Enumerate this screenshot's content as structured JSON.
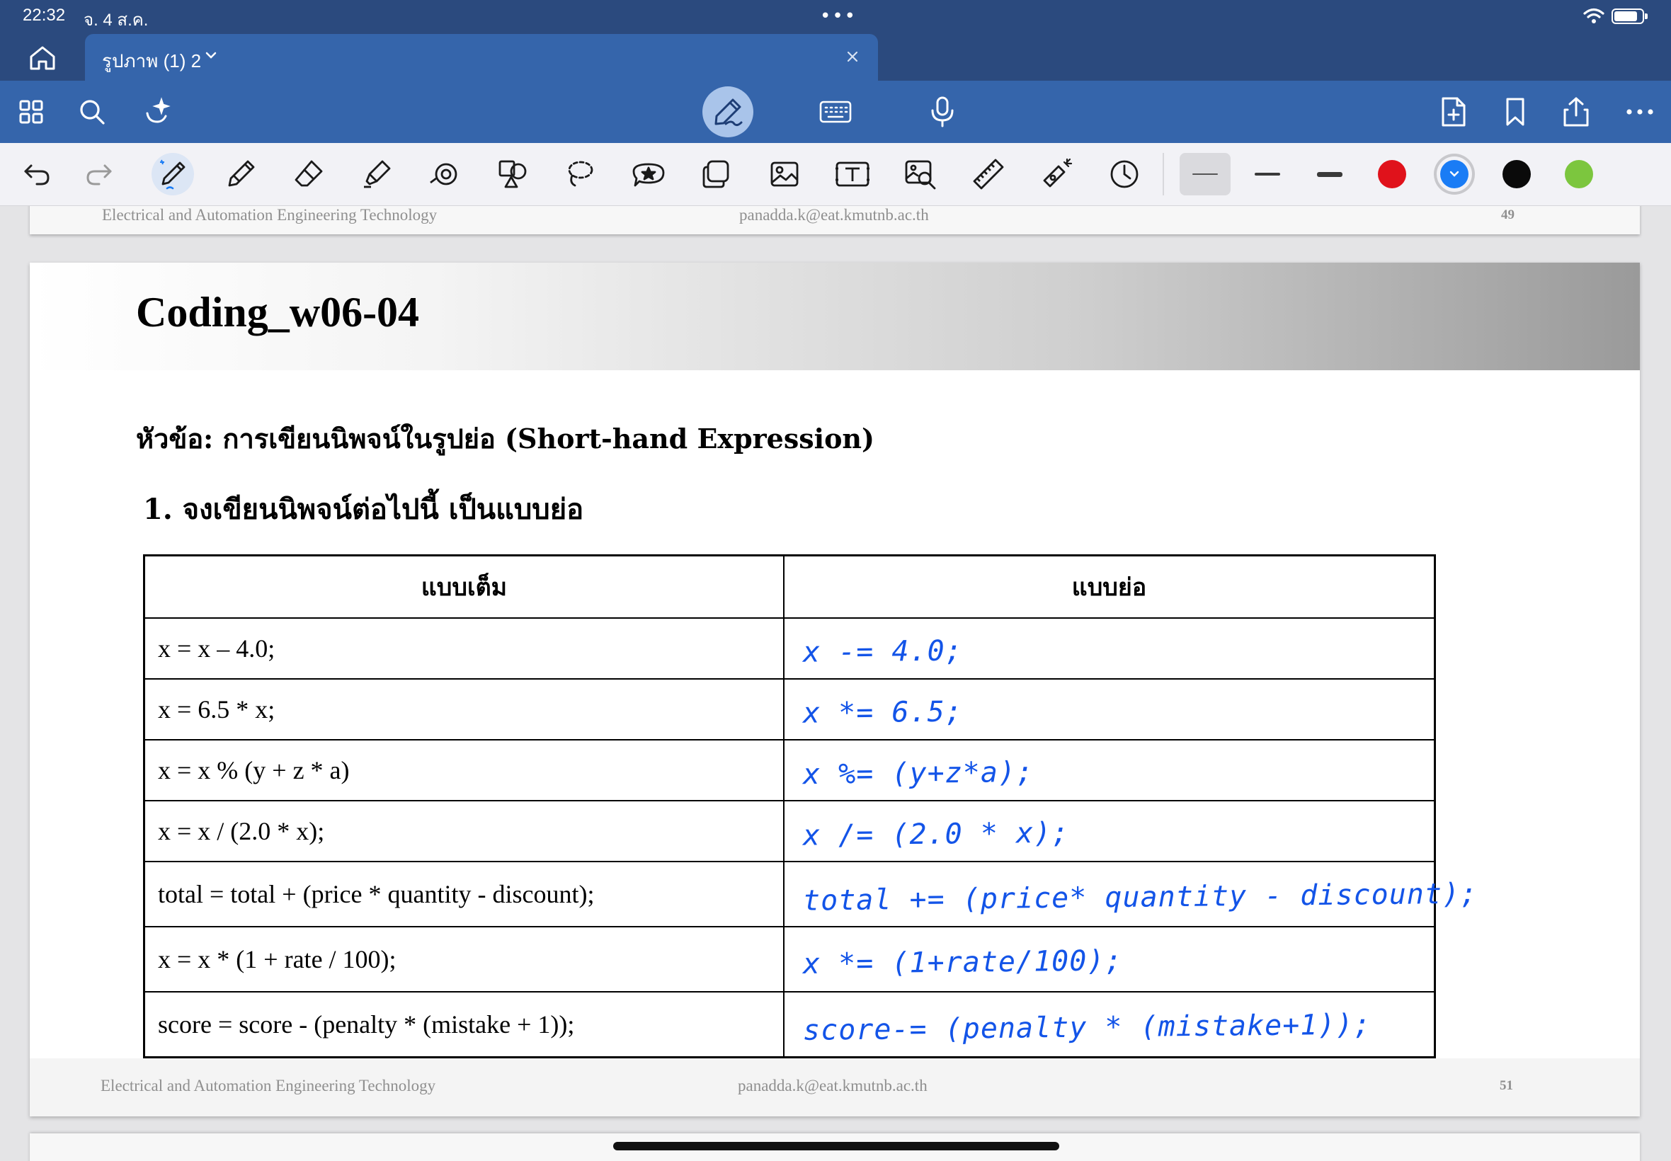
{
  "status": {
    "time": "22:32",
    "date": "จ. 4 ส.ค.",
    "dots": "•••",
    "battery_level": 0.85
  },
  "tab": {
    "title": "รูปภาพ (1) 2"
  },
  "colors": {
    "toolbar": "#3565ab",
    "status": "#2b4a7e",
    "ink": "#1354e8",
    "swatches": [
      "#e0121b",
      "#1a7cf5",
      "#0a0a0a",
      "#7cc63e"
    ]
  },
  "main_toolbar": {
    "icons": [
      "grid-icon",
      "search-icon",
      "ai-sparkle-icon",
      "pen-handwriting-icon",
      "keyboard-icon",
      "microphone-icon",
      "add-page-icon",
      "bookmark-icon",
      "share-icon",
      "more-icon"
    ]
  },
  "tools": [
    "undo-icon",
    "redo-icon",
    "ballpoint-pen-icon",
    "pencil-icon",
    "eraser-icon",
    "highlighter-icon",
    "tape-icon",
    "shapes-icon",
    "lasso-icon",
    "sticker-icon",
    "elements-icon",
    "image-icon",
    "text-box-icon",
    "image-search-icon",
    "ruler-icon",
    "laser-pointer-icon",
    "history-icon"
  ],
  "prev_slide": {
    "footer_left": "Electrical and Automation Engineering Technology",
    "footer_center": "panadda.k@eat.kmutnb.ac.th",
    "page": "49"
  },
  "slide": {
    "title": "Coding_w06-04",
    "topic": "หัวข้อ: การเขียนนิพจน์ในรูปย่อ (Short-hand Expression)",
    "question": "1. จงเขียนนิพจน์ต่อไปนี้ เป็นแบบย่อ",
    "table": {
      "headers": [
        "แบบเต็ม",
        "แบบย่อ"
      ],
      "rows": [
        {
          "full": "x = x – 4.0;",
          "short": "x -= 4.0;"
        },
        {
          "full": "x = 6.5 * x;",
          "short": "x *= 6.5;"
        },
        {
          "full": "x = x % (y + z * a)",
          "short": "x %= (y+z*a);"
        },
        {
          "full": "x = x / (2.0 * x);",
          "short": "x /= (2.0 * x);"
        },
        {
          "full": "total = total + (price * quantity - discount);",
          "short": "total += (price* quantity - discount);"
        },
        {
          "full": "x = x * (1 + rate / 100);",
          "short": "x *= (1+rate/100);"
        },
        {
          "full": "score = score - (penalty * (mistake + 1));",
          "short": "score-= (penalty * (mistake+1));"
        }
      ]
    },
    "footer_left": "Electrical and Automation Engineering Technology",
    "footer_center": "panadda.k@eat.kmutnb.ac.th",
    "page": "51"
  }
}
